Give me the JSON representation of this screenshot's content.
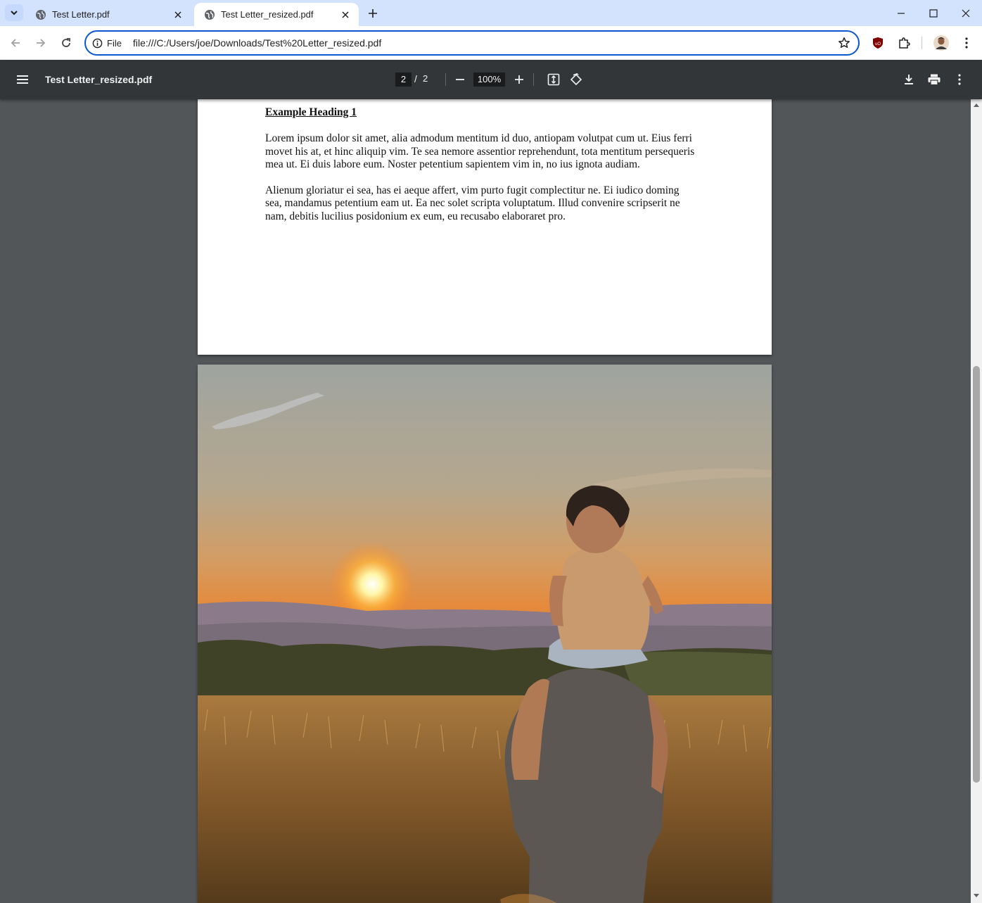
{
  "tabs": [
    {
      "title": "Test Letter.pdf",
      "active": false
    },
    {
      "title": "Test Letter_resized.pdf",
      "active": true
    }
  ],
  "omnibox": {
    "chip_label": "File",
    "url": "file:///C:/Users/joe/Downloads/Test%20Letter_resized.pdf"
  },
  "pdf_toolbar": {
    "title": "Test Letter_resized.pdf",
    "current_page": "2",
    "page_separator": "/",
    "total_pages": "2",
    "zoom": "100%"
  },
  "document": {
    "heading": "Example Heading 1",
    "paragraphs": [
      "Lorem ipsum dolor sit amet, alia admodum mentitum id duo, antiopam volutpat cum ut. Eius ferri movet his at, et hinc aliquip vim. Te sea nemore assentior reprehendunt, tota mentitum persequeris mea ut. Ei duis labore eum. Noster petentium sapientem vim in, no ius ignota audiam.",
      "Alienum gloriatur ei sea, has ei aeque affert, vim purto fugit complectitur ne. Ei iudico doming sea, mandamus petentium eam ut. Ea nec solet scripta voluptatum. Illud convenire scripserit ne nam, debitis lucilius posidonium ex eum, eu recusabo elaboraret pro."
    ]
  },
  "colors": {
    "tabstrip_bg": "#d3e3fd",
    "omnibox_border": "#0b57d0",
    "pdf_toolbar_bg": "#323639",
    "viewer_bg": "#525659"
  },
  "icons": [
    "tab-search-icon",
    "globe-icon",
    "close-icon",
    "plus-icon",
    "minimize-icon",
    "maximize-icon",
    "back-arrow-icon",
    "forward-arrow-icon",
    "reload-icon",
    "info-icon",
    "star-icon",
    "ublock-icon",
    "puzzle-icon",
    "profile-avatar",
    "kebab-menu-icon",
    "hamburger-menu-icon",
    "zoom-out-icon",
    "zoom-in-icon",
    "fit-page-icon",
    "rotate-icon",
    "download-icon",
    "print-icon"
  ]
}
